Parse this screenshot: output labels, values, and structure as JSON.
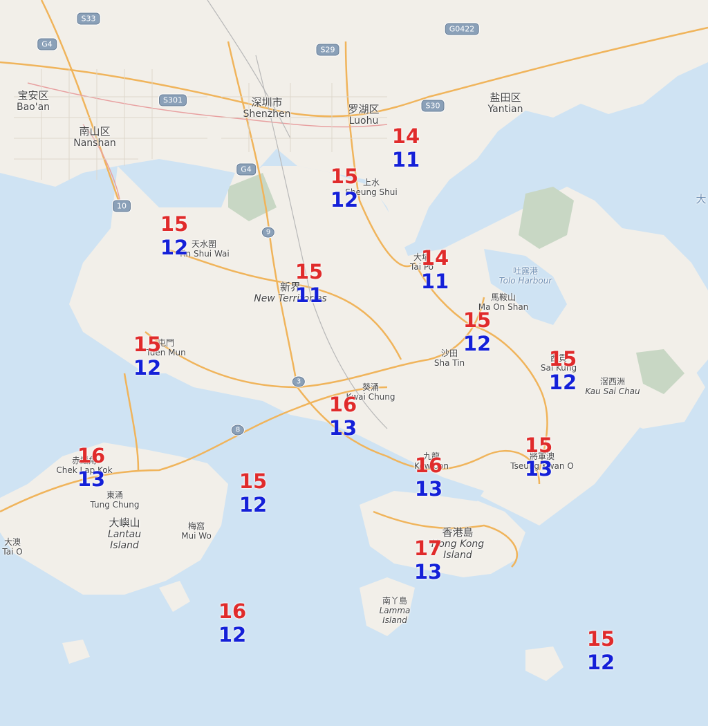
{
  "colors": {
    "max_temp": "#e02b2b",
    "min_temp": "#1420d8",
    "sea": "#cfe3f3",
    "land": "#f2efe9"
  },
  "road_shields": [
    "S33",
    "G4",
    "S29",
    "G0422",
    "S301",
    "S30",
    "G4",
    "10",
    "9",
    "3",
    "8"
  ],
  "places": [
    {
      "id": "baoan",
      "zh": "宝安区",
      "en": "Bao'an"
    },
    {
      "id": "nanshan",
      "zh": "南山区",
      "en": "Nanshan"
    },
    {
      "id": "shenzhen",
      "zh": "深圳市",
      "en": "Shenzhen"
    },
    {
      "id": "luohu",
      "zh": "罗湖区",
      "en": "Luohu"
    },
    {
      "id": "yantian",
      "zh": "盐田区",
      "en": "Yantian"
    },
    {
      "id": "sheungshui",
      "zh": "上水",
      "en": "Sheung Shui"
    },
    {
      "id": "tinshuiwai",
      "zh": "天水圍",
      "en": "Tin Shui Wai"
    },
    {
      "id": "taipo",
      "zh": "大埔",
      "en": "Tai Po"
    },
    {
      "id": "toloharbour",
      "zh": "吐露港",
      "en": "Tolo Harbour"
    },
    {
      "id": "newterritories",
      "zh": "新界",
      "en": "New Territories"
    },
    {
      "id": "maonshan",
      "zh": "馬鞍山",
      "en": "Ma On Shan"
    },
    {
      "id": "tuenmun",
      "zh": "屯門",
      "en": "Tuen Mun"
    },
    {
      "id": "shatin",
      "zh": "沙田",
      "en": "Sha Tin"
    },
    {
      "id": "saikung",
      "zh": "西貢",
      "en": "Sai Kung"
    },
    {
      "id": "kausaichau",
      "zh": "滘西洲",
      "en": "Kau Sai Chau"
    },
    {
      "id": "kwaichung",
      "zh": "葵涌",
      "en": "Kwai Chung"
    },
    {
      "id": "cheklapkok",
      "zh": "赤鱲角",
      "en": "Chek Lap Kok"
    },
    {
      "id": "kowloon",
      "zh": "九龍",
      "en": "Kowloon"
    },
    {
      "id": "tseungkwano",
      "zh": "將軍澳",
      "en": "Tseung Kwan O"
    },
    {
      "id": "tungchung",
      "zh": "東涌",
      "en": "Tung Chung"
    },
    {
      "id": "lantau",
      "zh": "大嶼山",
      "en": "Lantau Island"
    },
    {
      "id": "muiwo",
      "zh": "梅窩",
      "en": "Mui Wo"
    },
    {
      "id": "hongkongisland",
      "zh": "香港島",
      "en": "Hong Kong Island"
    },
    {
      "id": "taio",
      "zh": "大澳",
      "en": "Tai O"
    },
    {
      "id": "lamma",
      "zh": "南丫島",
      "en": "Lamma Island"
    },
    {
      "id": "edge",
      "zh": "大",
      "en": ""
    }
  ],
  "stations": [
    {
      "id": "luohu",
      "max": "14",
      "min": "11"
    },
    {
      "id": "sheung-shui",
      "max": "15",
      "min": "12"
    },
    {
      "id": "tin-shui-wai",
      "max": "15",
      "min": "12"
    },
    {
      "id": "tai-po",
      "max": "14",
      "min": "11"
    },
    {
      "id": "new-territories",
      "max": "15",
      "min": "11"
    },
    {
      "id": "ma-on-shan",
      "max": "15",
      "min": "12"
    },
    {
      "id": "tuen-mun",
      "max": "15",
      "min": "12"
    },
    {
      "id": "sai-kung",
      "max": "15",
      "min": "12"
    },
    {
      "id": "kwai-chung",
      "max": "16",
      "min": "13"
    },
    {
      "id": "chek-lap-kok",
      "max": "16",
      "min": "13"
    },
    {
      "id": "tseung-kwan-o",
      "max": "15",
      "min": "13"
    },
    {
      "id": "kowloon",
      "max": "16",
      "min": "13"
    },
    {
      "id": "sea-west",
      "max": "15",
      "min": "12"
    },
    {
      "id": "hong-kong-island",
      "max": "17",
      "min": "13"
    },
    {
      "id": "south-lantau-sea",
      "max": "16",
      "min": "12"
    },
    {
      "id": "south-east-sea",
      "max": "15",
      "min": "12"
    }
  ]
}
